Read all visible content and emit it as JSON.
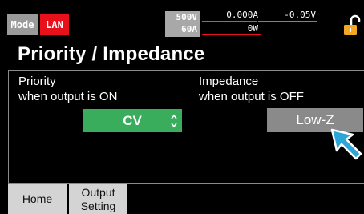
{
  "status_bar": {
    "mode_label": "Mode",
    "lan_label": "LAN",
    "rated_voltage": "500V",
    "rated_current": "60A",
    "measured_current": "0.000A",
    "measured_voltage": "-0.05V",
    "measured_power": "0W",
    "lock_icon": "open-lock-icon"
  },
  "page": {
    "title": "Priority / Impedance"
  },
  "priority": {
    "label_line1": "Priority",
    "label_line2": "when output is ON",
    "value": "CV"
  },
  "impedance": {
    "label_line1": "Impedance",
    "label_line2": "when output is OFF",
    "value": "Low-Z"
  },
  "tabs": [
    {
      "label": "Home"
    },
    {
      "label_line1": "Output",
      "label_line2": "Setting"
    }
  ],
  "colors": {
    "background": "#000000",
    "accent_green": "#3aad5c",
    "lan_red": "#e8101a",
    "lock_orange": "#f5a623",
    "cursor_blue": "#2aa7d8"
  }
}
